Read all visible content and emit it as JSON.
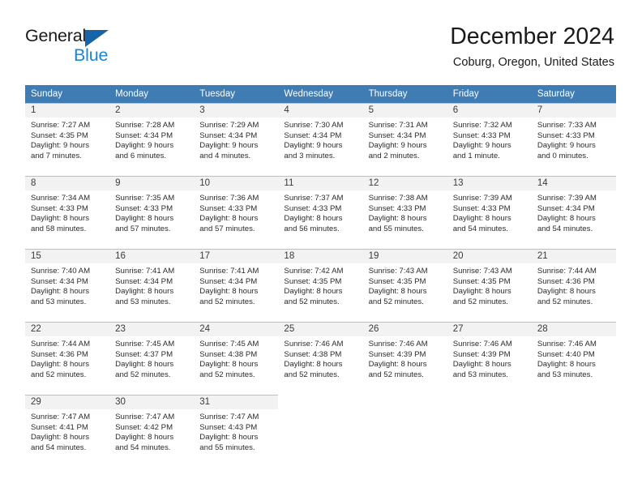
{
  "brand": {
    "name_part1": "General",
    "name_part2": "Blue",
    "triangle_color": "#1565a8",
    "blue_color": "#1a86d8"
  },
  "header": {
    "month_title": "December 2024",
    "location": "Coburg, Oregon, United States"
  },
  "theme": {
    "header_row_bg": "#3f7cb4",
    "header_row_text": "#ffffff",
    "daynum_band_bg": "#f2f2f2",
    "cell_border": "#bfbfbf"
  },
  "weekday_headers": [
    "Sunday",
    "Monday",
    "Tuesday",
    "Wednesday",
    "Thursday",
    "Friday",
    "Saturday"
  ],
  "weeks": [
    [
      {
        "day": "1",
        "sunrise": "Sunrise: 7:27 AM",
        "sunset": "Sunset: 4:35 PM",
        "daylight_line1": "Daylight: 9 hours",
        "daylight_line2": "and 7 minutes."
      },
      {
        "day": "2",
        "sunrise": "Sunrise: 7:28 AM",
        "sunset": "Sunset: 4:34 PM",
        "daylight_line1": "Daylight: 9 hours",
        "daylight_line2": "and 6 minutes."
      },
      {
        "day": "3",
        "sunrise": "Sunrise: 7:29 AM",
        "sunset": "Sunset: 4:34 PM",
        "daylight_line1": "Daylight: 9 hours",
        "daylight_line2": "and 4 minutes."
      },
      {
        "day": "4",
        "sunrise": "Sunrise: 7:30 AM",
        "sunset": "Sunset: 4:34 PM",
        "daylight_line1": "Daylight: 9 hours",
        "daylight_line2": "and 3 minutes."
      },
      {
        "day": "5",
        "sunrise": "Sunrise: 7:31 AM",
        "sunset": "Sunset: 4:34 PM",
        "daylight_line1": "Daylight: 9 hours",
        "daylight_line2": "and 2 minutes."
      },
      {
        "day": "6",
        "sunrise": "Sunrise: 7:32 AM",
        "sunset": "Sunset: 4:33 PM",
        "daylight_line1": "Daylight: 9 hours",
        "daylight_line2": "and 1 minute."
      },
      {
        "day": "7",
        "sunrise": "Sunrise: 7:33 AM",
        "sunset": "Sunset: 4:33 PM",
        "daylight_line1": "Daylight: 9 hours",
        "daylight_line2": "and 0 minutes."
      }
    ],
    [
      {
        "day": "8",
        "sunrise": "Sunrise: 7:34 AM",
        "sunset": "Sunset: 4:33 PM",
        "daylight_line1": "Daylight: 8 hours",
        "daylight_line2": "and 58 minutes."
      },
      {
        "day": "9",
        "sunrise": "Sunrise: 7:35 AM",
        "sunset": "Sunset: 4:33 PM",
        "daylight_line1": "Daylight: 8 hours",
        "daylight_line2": "and 57 minutes."
      },
      {
        "day": "10",
        "sunrise": "Sunrise: 7:36 AM",
        "sunset": "Sunset: 4:33 PM",
        "daylight_line1": "Daylight: 8 hours",
        "daylight_line2": "and 57 minutes."
      },
      {
        "day": "11",
        "sunrise": "Sunrise: 7:37 AM",
        "sunset": "Sunset: 4:33 PM",
        "daylight_line1": "Daylight: 8 hours",
        "daylight_line2": "and 56 minutes."
      },
      {
        "day": "12",
        "sunrise": "Sunrise: 7:38 AM",
        "sunset": "Sunset: 4:33 PM",
        "daylight_line1": "Daylight: 8 hours",
        "daylight_line2": "and 55 minutes."
      },
      {
        "day": "13",
        "sunrise": "Sunrise: 7:39 AM",
        "sunset": "Sunset: 4:33 PM",
        "daylight_line1": "Daylight: 8 hours",
        "daylight_line2": "and 54 minutes."
      },
      {
        "day": "14",
        "sunrise": "Sunrise: 7:39 AM",
        "sunset": "Sunset: 4:34 PM",
        "daylight_line1": "Daylight: 8 hours",
        "daylight_line2": "and 54 minutes."
      }
    ],
    [
      {
        "day": "15",
        "sunrise": "Sunrise: 7:40 AM",
        "sunset": "Sunset: 4:34 PM",
        "daylight_line1": "Daylight: 8 hours",
        "daylight_line2": "and 53 minutes."
      },
      {
        "day": "16",
        "sunrise": "Sunrise: 7:41 AM",
        "sunset": "Sunset: 4:34 PM",
        "daylight_line1": "Daylight: 8 hours",
        "daylight_line2": "and 53 minutes."
      },
      {
        "day": "17",
        "sunrise": "Sunrise: 7:41 AM",
        "sunset": "Sunset: 4:34 PM",
        "daylight_line1": "Daylight: 8 hours",
        "daylight_line2": "and 52 minutes."
      },
      {
        "day": "18",
        "sunrise": "Sunrise: 7:42 AM",
        "sunset": "Sunset: 4:35 PM",
        "daylight_line1": "Daylight: 8 hours",
        "daylight_line2": "and 52 minutes."
      },
      {
        "day": "19",
        "sunrise": "Sunrise: 7:43 AM",
        "sunset": "Sunset: 4:35 PM",
        "daylight_line1": "Daylight: 8 hours",
        "daylight_line2": "and 52 minutes."
      },
      {
        "day": "20",
        "sunrise": "Sunrise: 7:43 AM",
        "sunset": "Sunset: 4:35 PM",
        "daylight_line1": "Daylight: 8 hours",
        "daylight_line2": "and 52 minutes."
      },
      {
        "day": "21",
        "sunrise": "Sunrise: 7:44 AM",
        "sunset": "Sunset: 4:36 PM",
        "daylight_line1": "Daylight: 8 hours",
        "daylight_line2": "and 52 minutes."
      }
    ],
    [
      {
        "day": "22",
        "sunrise": "Sunrise: 7:44 AM",
        "sunset": "Sunset: 4:36 PM",
        "daylight_line1": "Daylight: 8 hours",
        "daylight_line2": "and 52 minutes."
      },
      {
        "day": "23",
        "sunrise": "Sunrise: 7:45 AM",
        "sunset": "Sunset: 4:37 PM",
        "daylight_line1": "Daylight: 8 hours",
        "daylight_line2": "and 52 minutes."
      },
      {
        "day": "24",
        "sunrise": "Sunrise: 7:45 AM",
        "sunset": "Sunset: 4:38 PM",
        "daylight_line1": "Daylight: 8 hours",
        "daylight_line2": "and 52 minutes."
      },
      {
        "day": "25",
        "sunrise": "Sunrise: 7:46 AM",
        "sunset": "Sunset: 4:38 PM",
        "daylight_line1": "Daylight: 8 hours",
        "daylight_line2": "and 52 minutes."
      },
      {
        "day": "26",
        "sunrise": "Sunrise: 7:46 AM",
        "sunset": "Sunset: 4:39 PM",
        "daylight_line1": "Daylight: 8 hours",
        "daylight_line2": "and 52 minutes."
      },
      {
        "day": "27",
        "sunrise": "Sunrise: 7:46 AM",
        "sunset": "Sunset: 4:39 PM",
        "daylight_line1": "Daylight: 8 hours",
        "daylight_line2": "and 53 minutes."
      },
      {
        "day": "28",
        "sunrise": "Sunrise: 7:46 AM",
        "sunset": "Sunset: 4:40 PM",
        "daylight_line1": "Daylight: 8 hours",
        "daylight_line2": "and 53 minutes."
      }
    ],
    [
      {
        "day": "29",
        "sunrise": "Sunrise: 7:47 AM",
        "sunset": "Sunset: 4:41 PM",
        "daylight_line1": "Daylight: 8 hours",
        "daylight_line2": "and 54 minutes."
      },
      {
        "day": "30",
        "sunrise": "Sunrise: 7:47 AM",
        "sunset": "Sunset: 4:42 PM",
        "daylight_line1": "Daylight: 8 hours",
        "daylight_line2": "and 54 minutes."
      },
      {
        "day": "31",
        "sunrise": "Sunrise: 7:47 AM",
        "sunset": "Sunset: 4:43 PM",
        "daylight_line1": "Daylight: 8 hours",
        "daylight_line2": "and 55 minutes."
      },
      null,
      null,
      null,
      null
    ]
  ]
}
